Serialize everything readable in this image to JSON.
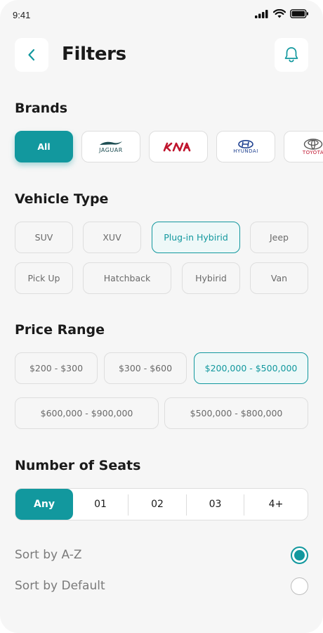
{
  "status_bar": {
    "time": "9:41"
  },
  "header": {
    "title": "Filters"
  },
  "brands": {
    "title": "Brands",
    "all_label": "All",
    "logos": [
      {
        "name": "JAGUAR",
        "color": "#1d4d52"
      },
      {
        "name": "KIA",
        "color": "#c0152e"
      },
      {
        "name": "HYUNDAI",
        "color": "#1d3f8f"
      },
      {
        "name": "TOYOTA",
        "color": "#c0152e"
      }
    ]
  },
  "vehicle_type": {
    "title": "Vehicle Type",
    "options": [
      "SUV",
      "XUV",
      "Plug-in Hybirid",
      "Jeep",
      "Pick Up",
      "Hatchback",
      "Hybirid",
      "Van"
    ],
    "selected": "Plug-in Hybirid"
  },
  "price_range": {
    "title": "Price Range",
    "options": [
      "$200 - $300",
      "$300 - $600",
      "$200,000 - $500,000",
      "$600,000 - $900,000",
      "$500,000 - $800,000"
    ],
    "selected": "$200,000 - $500,000"
  },
  "seats": {
    "title": "Number of Seats",
    "options": [
      "Any",
      "01",
      "02",
      "03",
      "4+"
    ],
    "selected": "Any"
  },
  "sort": {
    "options": [
      {
        "label": "Sort by A-Z",
        "checked": true
      },
      {
        "label": "Sort by Default",
        "checked": false
      }
    ]
  },
  "colors": {
    "accent": "#12989e",
    "background": "#f6f6f6"
  }
}
